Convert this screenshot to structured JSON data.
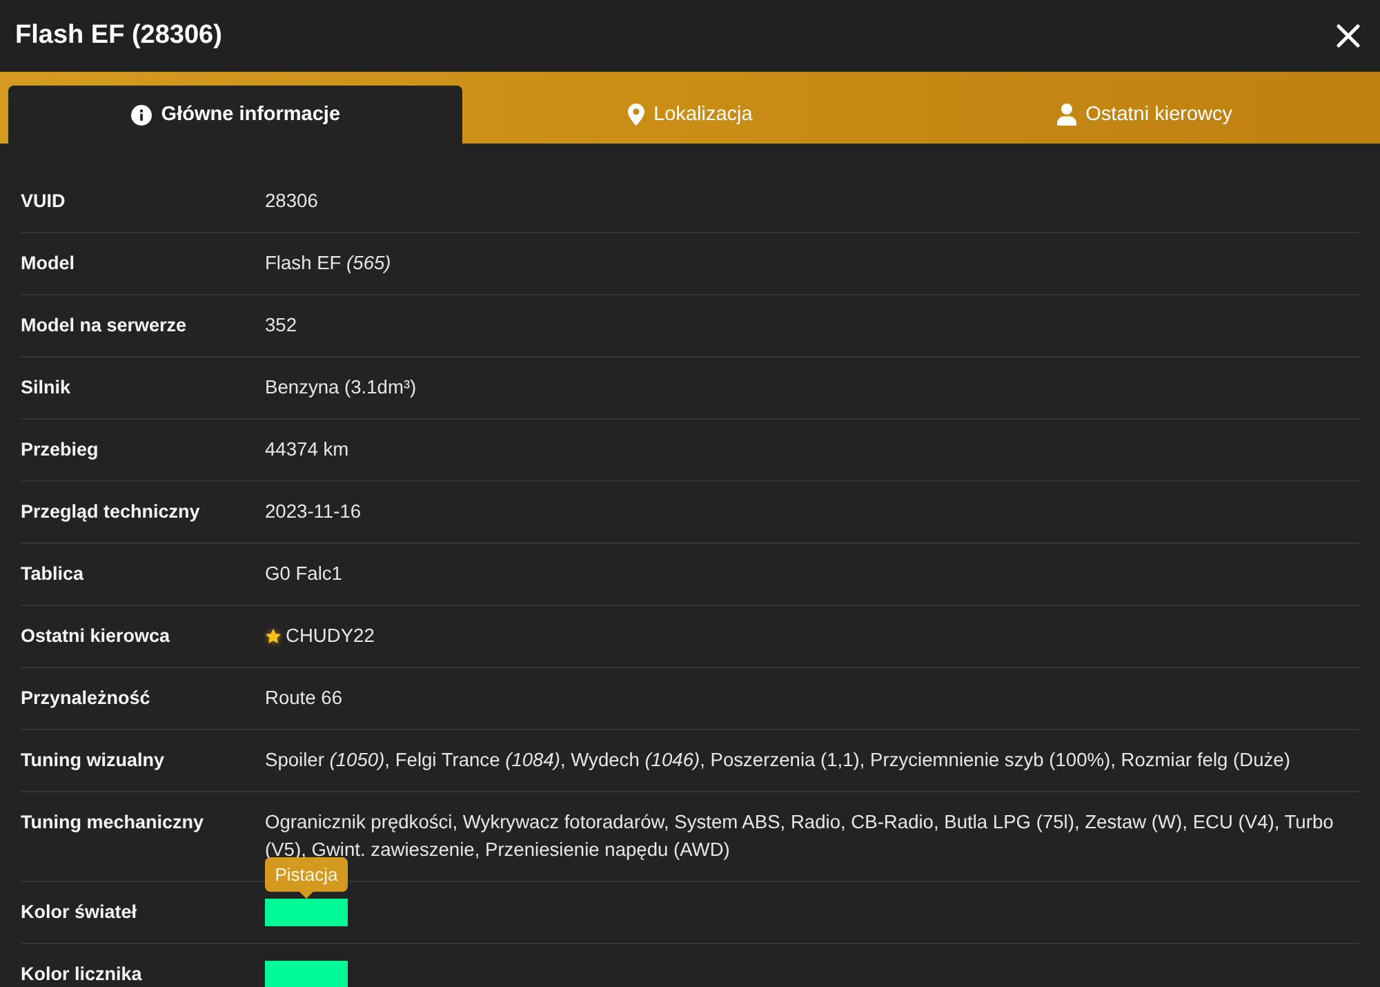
{
  "window": {
    "title": "Flash EF (28306)"
  },
  "tabs": [
    {
      "label": "Główne informacje",
      "selected": true
    },
    {
      "label": "Lokalizacja",
      "selected": false
    },
    {
      "label": "Ostatni kierowcy",
      "selected": false
    }
  ],
  "details": {
    "rows": [
      {
        "label": "VUID",
        "kind": "text",
        "value": "28306"
      },
      {
        "label": "Model",
        "kind": "text",
        "value": "Flash EF *(565)*"
      },
      {
        "label": "Model na serwerze",
        "kind": "text",
        "value": "352"
      },
      {
        "label": "Silnik",
        "kind": "text",
        "value": "Benzyna (3.1dm³)"
      },
      {
        "label": "Przebieg",
        "kind": "text",
        "value": "44374 km"
      },
      {
        "label": "Przegląd techniczny",
        "kind": "text",
        "value": "2023-11-16"
      },
      {
        "label": "Tablica",
        "kind": "text",
        "value": "G0 Falc1"
      },
      {
        "label": "Ostatni kierowca",
        "kind": "driver",
        "value": "CHUDY22",
        "starred": true
      },
      {
        "label": "Przynależność",
        "kind": "text",
        "value": "Route 66"
      },
      {
        "label": "Tuning wizualny",
        "kind": "text",
        "value": "Spoiler *(1050)*, Felgi Trance *(1084)*, Wydech *(1046)*, Poszerzenia (1,1), Przyciemnienie szyb (100%), Rozmiar felg (Duże)"
      },
      {
        "label": "Tuning mechaniczny",
        "kind": "text",
        "value": "Ogranicznik prędkości, Wykrywacz fotoradarów, System ABS, Radio, CB-Radio, Butla LPG (75l), Zestaw (W), ECU (V4), Turbo (V5), Gwint. zawieszenie, Przeniesienie napędu (AWD)"
      },
      {
        "label": "Kolor świateł",
        "kind": "color",
        "color": "#00fa96",
        "tooltip": "Pistacja"
      },
      {
        "label": "Kolor licznika",
        "kind": "color",
        "color": "#00fa96"
      }
    ]
  }
}
